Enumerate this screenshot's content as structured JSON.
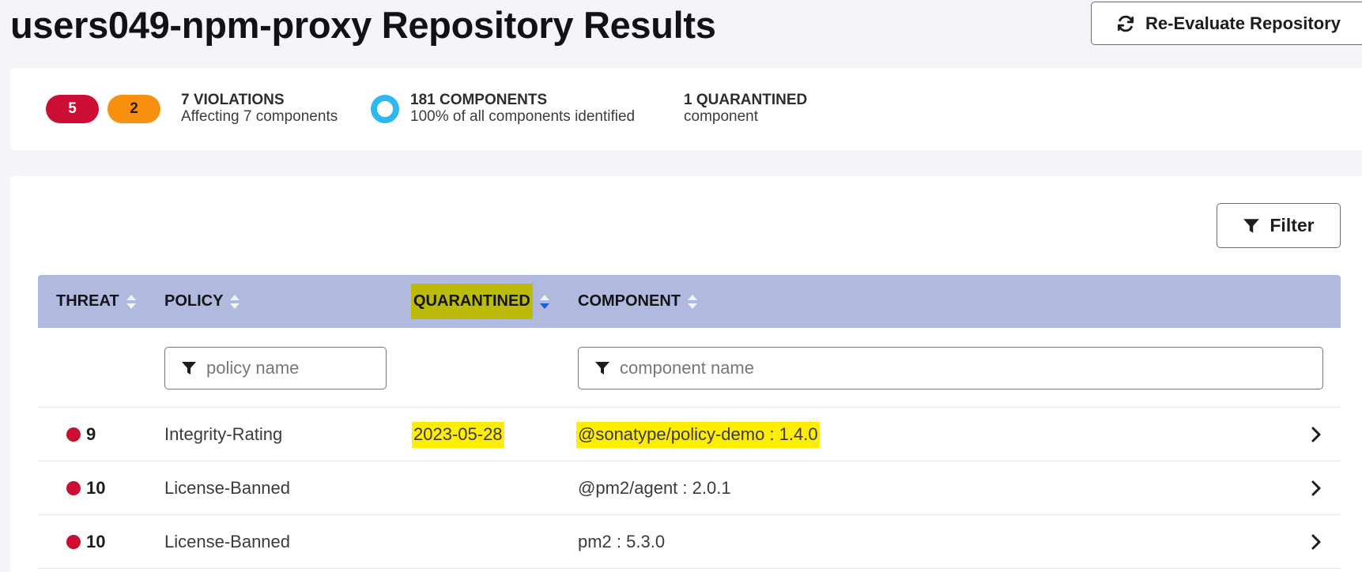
{
  "page": {
    "title": "users049-npm-proxy Repository Results",
    "reevaluate_label": "Re-Evaluate Repository"
  },
  "summary": {
    "critical_count": "5",
    "severe_count": "2",
    "violations_title": "7 VIOLATIONS",
    "violations_sub": "Affecting 7 components",
    "components_title": "181 COMPONENTS",
    "components_sub": "100% of all components identified",
    "quarantined_title": "1 QUARANTINED",
    "quarantined_sub": "component",
    "colors": {
      "critical": "#cc0d34",
      "severe": "#f7900f",
      "ring": "#2eb8ef"
    }
  },
  "toolbar": {
    "filter_label": "Filter"
  },
  "table": {
    "columns": {
      "threat": "THREAT",
      "policy": "POLICY",
      "quarantined": "QUARANTINED",
      "component": "COMPONENT"
    },
    "sort_active": "quarantined",
    "quarantined_col_highlighted": true,
    "filters": {
      "policy_placeholder": "policy name",
      "component_placeholder": "component name"
    },
    "rows": [
      {
        "threat": "9",
        "policy": "Integrity-Rating",
        "quarantined": "2023-05-28",
        "component": "@sonatype/policy-demo : 1.4.0",
        "highlight": true
      },
      {
        "threat": "10",
        "policy": "License-Banned",
        "quarantined": "",
        "component": "@pm2/agent : 2.0.1",
        "highlight": false
      },
      {
        "threat": "10",
        "policy": "License-Banned",
        "quarantined": "",
        "component": "pm2 : 5.3.0",
        "highlight": false
      }
    ]
  },
  "icons": {
    "reevaluate": "refresh-icon",
    "filter": "funnel-icon",
    "sort": "sort-icon",
    "row_open": "chevron-right-icon"
  }
}
